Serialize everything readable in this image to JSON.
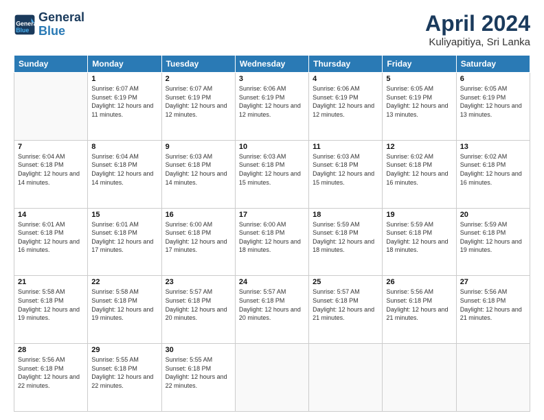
{
  "logo": {
    "line1": "General",
    "line2": "Blue"
  },
  "title": "April 2024",
  "subtitle": "Kuliyapitiya, Sri Lanka",
  "weekdays": [
    "Sunday",
    "Monday",
    "Tuesday",
    "Wednesday",
    "Thursday",
    "Friday",
    "Saturday"
  ],
  "weeks": [
    [
      {
        "num": "",
        "empty": true
      },
      {
        "num": "1",
        "sunrise": "6:07 AM",
        "sunset": "6:19 PM",
        "daylight": "12 hours and 11 minutes."
      },
      {
        "num": "2",
        "sunrise": "6:07 AM",
        "sunset": "6:19 PM",
        "daylight": "12 hours and 12 minutes."
      },
      {
        "num": "3",
        "sunrise": "6:06 AM",
        "sunset": "6:19 PM",
        "daylight": "12 hours and 12 minutes."
      },
      {
        "num": "4",
        "sunrise": "6:06 AM",
        "sunset": "6:19 PM",
        "daylight": "12 hours and 12 minutes."
      },
      {
        "num": "5",
        "sunrise": "6:05 AM",
        "sunset": "6:19 PM",
        "daylight": "12 hours and 13 minutes."
      },
      {
        "num": "6",
        "sunrise": "6:05 AM",
        "sunset": "6:19 PM",
        "daylight": "12 hours and 13 minutes."
      }
    ],
    [
      {
        "num": "7",
        "sunrise": "6:04 AM",
        "sunset": "6:18 PM",
        "daylight": "12 hours and 14 minutes."
      },
      {
        "num": "8",
        "sunrise": "6:04 AM",
        "sunset": "6:18 PM",
        "daylight": "12 hours and 14 minutes."
      },
      {
        "num": "9",
        "sunrise": "6:03 AM",
        "sunset": "6:18 PM",
        "daylight": "12 hours and 14 minutes."
      },
      {
        "num": "10",
        "sunrise": "6:03 AM",
        "sunset": "6:18 PM",
        "daylight": "12 hours and 15 minutes."
      },
      {
        "num": "11",
        "sunrise": "6:03 AM",
        "sunset": "6:18 PM",
        "daylight": "12 hours and 15 minutes."
      },
      {
        "num": "12",
        "sunrise": "6:02 AM",
        "sunset": "6:18 PM",
        "daylight": "12 hours and 16 minutes."
      },
      {
        "num": "13",
        "sunrise": "6:02 AM",
        "sunset": "6:18 PM",
        "daylight": "12 hours and 16 minutes."
      }
    ],
    [
      {
        "num": "14",
        "sunrise": "6:01 AM",
        "sunset": "6:18 PM",
        "daylight": "12 hours and 16 minutes."
      },
      {
        "num": "15",
        "sunrise": "6:01 AM",
        "sunset": "6:18 PM",
        "daylight": "12 hours and 17 minutes."
      },
      {
        "num": "16",
        "sunrise": "6:00 AM",
        "sunset": "6:18 PM",
        "daylight": "12 hours and 17 minutes."
      },
      {
        "num": "17",
        "sunrise": "6:00 AM",
        "sunset": "6:18 PM",
        "daylight": "12 hours and 18 minutes."
      },
      {
        "num": "18",
        "sunrise": "5:59 AM",
        "sunset": "6:18 PM",
        "daylight": "12 hours and 18 minutes."
      },
      {
        "num": "19",
        "sunrise": "5:59 AM",
        "sunset": "6:18 PM",
        "daylight": "12 hours and 18 minutes."
      },
      {
        "num": "20",
        "sunrise": "5:59 AM",
        "sunset": "6:18 PM",
        "daylight": "12 hours and 19 minutes."
      }
    ],
    [
      {
        "num": "21",
        "sunrise": "5:58 AM",
        "sunset": "6:18 PM",
        "daylight": "12 hours and 19 minutes."
      },
      {
        "num": "22",
        "sunrise": "5:58 AM",
        "sunset": "6:18 PM",
        "daylight": "12 hours and 19 minutes."
      },
      {
        "num": "23",
        "sunrise": "5:57 AM",
        "sunset": "6:18 PM",
        "daylight": "12 hours and 20 minutes."
      },
      {
        "num": "24",
        "sunrise": "5:57 AM",
        "sunset": "6:18 PM",
        "daylight": "12 hours and 20 minutes."
      },
      {
        "num": "25",
        "sunrise": "5:57 AM",
        "sunset": "6:18 PM",
        "daylight": "12 hours and 21 minutes."
      },
      {
        "num": "26",
        "sunrise": "5:56 AM",
        "sunset": "6:18 PM",
        "daylight": "12 hours and 21 minutes."
      },
      {
        "num": "27",
        "sunrise": "5:56 AM",
        "sunset": "6:18 PM",
        "daylight": "12 hours and 21 minutes."
      }
    ],
    [
      {
        "num": "28",
        "sunrise": "5:56 AM",
        "sunset": "6:18 PM",
        "daylight": "12 hours and 22 minutes."
      },
      {
        "num": "29",
        "sunrise": "5:55 AM",
        "sunset": "6:18 PM",
        "daylight": "12 hours and 22 minutes."
      },
      {
        "num": "30",
        "sunrise": "5:55 AM",
        "sunset": "6:18 PM",
        "daylight": "12 hours and 22 minutes."
      },
      {
        "num": "",
        "empty": true
      },
      {
        "num": "",
        "empty": true
      },
      {
        "num": "",
        "empty": true
      },
      {
        "num": "",
        "empty": true
      }
    ]
  ]
}
